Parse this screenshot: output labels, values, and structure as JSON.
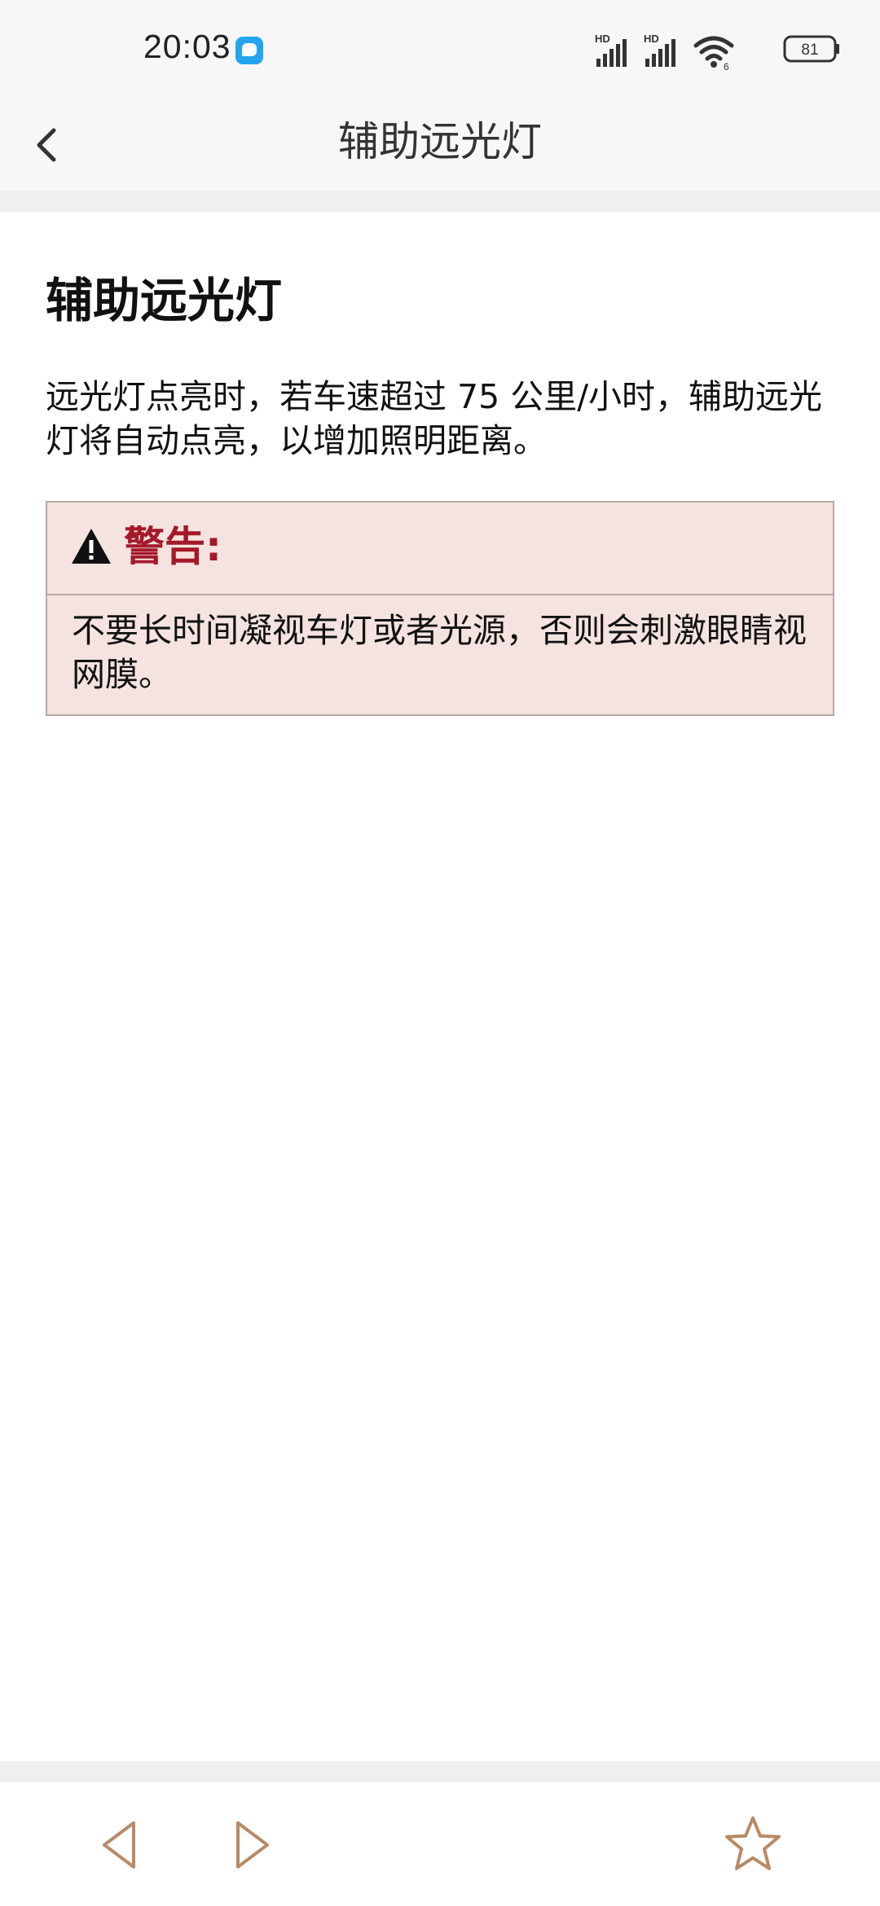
{
  "status_bar": {
    "time": "20:03",
    "battery": "81",
    "network_1": "HD",
    "network_2": "HD"
  },
  "header": {
    "title": "辅助远光灯"
  },
  "article": {
    "title": "辅助远光灯",
    "body": "远光灯点亮时，若车速超过 75 公里/小时，辅助远光灯将自动点亮，以增加照明距离。",
    "warning": {
      "label": "警告:",
      "text": "不要长时间凝视车灯或者光源，否则会刺激眼睛视网膜。"
    }
  },
  "icons": {
    "back": "chevron-left-icon",
    "warning": "warning-triangle-icon",
    "prev": "triangle-left-icon",
    "next": "triangle-right-icon",
    "favorite": "star-outline-icon"
  },
  "colors": {
    "warning_label": "#a4192a",
    "warning_bg": "#f4e3de",
    "nav_icon": "#b88a65",
    "notification": "#25a5ee"
  }
}
